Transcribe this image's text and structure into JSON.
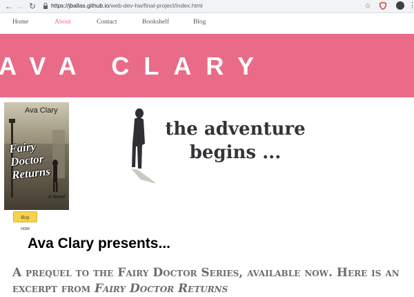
{
  "browser": {
    "url_host": "https://jballas.github.io",
    "url_path": "/web-dev-hw/final-project/index.html",
    "icons": [
      "back-arrow-icon",
      "forward-arrow-icon",
      "reload-icon",
      "lock-icon",
      "star-icon",
      "shield-extension-icon",
      "profile-avatar",
      "more-menu-icon"
    ]
  },
  "nav": {
    "items": [
      {
        "label": "Home"
      },
      {
        "label": "About"
      },
      {
        "label": "Contact"
      },
      {
        "label": "Bookshelf"
      },
      {
        "label": "Blog"
      }
    ],
    "active": "About",
    "active_color": "#e76c87"
  },
  "hero": {
    "title": "AVA CLARY",
    "background": "#e96b88"
  },
  "book": {
    "author": "Ava Clary",
    "title_lines": [
      "Fairy",
      "Doctor",
      "Returns"
    ],
    "subtitle": "A Novel",
    "buy_label": "Buy now"
  },
  "tagline": {
    "line1": "the adventure",
    "line2": "begins ..."
  },
  "presents": "Ava Clary presents...",
  "excerpt": {
    "text": "A prequel to the Fairy Doctor Series, available now. Here is an excerpt from ",
    "book_title": "Fairy Doctor Returns"
  }
}
